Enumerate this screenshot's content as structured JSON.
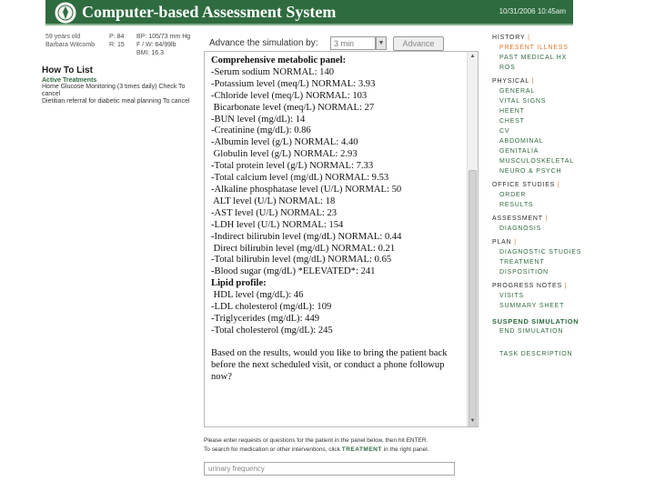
{
  "header": {
    "title": "Computer-based Assessment System",
    "date": "10/31/2006 10:45am"
  },
  "patient": {
    "age": "59 years old",
    "name": "Barbara Witcomb",
    "p_label": "P:",
    "p_value": "84",
    "r_label": "R:",
    "r_value": "15",
    "bp_label": "BP:",
    "bp_value": "105/73 mm Hg",
    "fw_label": "F / W:",
    "fw_value": "64/99lb",
    "bmi_label": "BMI:",
    "bmi_value": "16.3"
  },
  "howto": {
    "title": "How To List",
    "subtitle": "Active Treatments",
    "items": [
      "Home Glucose Monitoring (3 times daily) Check  To cancel",
      "Dietitian referral for diabetic meal planning  To cancel"
    ]
  },
  "advance": {
    "label": "Advance the simulation by:",
    "select_value": "3 min",
    "button": "Advance"
  },
  "results": {
    "heading": "Comprehensive metabolic panel:",
    "lines": [
      "-Serum sodium NORMAL: 140",
      "-Potassium level (meq/L) NORMAL: 3.93",
      "-Chloride level (meq/L) NORMAL: 103",
      " Bicarbonate level (meq/L) NORMAL: 27",
      "-BUN level (mg/dL): 14",
      "-Creatinine (mg/dL): 0.86",
      "-Albumin level (g/L) NORMAL: 4.40",
      " Globulin level (g/L) NORMAL: 2.93",
      "-Total protein level (g/L) NORMAL: 7.33",
      "-Total calcium level (mg/dL) NORMAL: 9.53",
      "-Alkaline phosphatase level (U/L) NORMAL: 50",
      " ALT level (U/L) NORMAL: 18",
      "-AST level (U/L) NORMAL: 23",
      "-LDH level (U/L) NORMAL: 154",
      "-Indirect bilirubin level (mg/dL) NORMAL: 0.44",
      " Direct bilirubin level (mg/dL) NORMAL: 0.21",
      "-Total bilirubin level (mg/dL) NORMAL: 0.65",
      "-Blood sugar (mg/dL) *ELEVATED*: 241"
    ],
    "lipid_heading": "Lipid profile:",
    "lipid_lines": [
      " HDL level (mg/dL): 46",
      "-LDL cholesterol (mg/dL): 109",
      "-Triglycerides (mg/dL): 449",
      "-Total cholesterol (mg/dL): 245"
    ],
    "question": "Based on the results, would you like to bring the patient back before the next scheduled visit, or conduct a phone followup now?"
  },
  "instructions": {
    "line1": "Please enter requests or questions for the patient in the panel below, then hit ENTER.",
    "line2_prefix": "To search for medication or other interventions, click",
    "line2_keyword": "TREATMENT",
    "line2_suffix": "in the right panel."
  },
  "entry": {
    "value": "urinary frequency"
  },
  "menu": {
    "history": "HISTORY",
    "present_illness": "PRESENT ILLNESS",
    "past_medical_hx": "PAST MEDICAL HX",
    "ros": "ROS",
    "physical": "PHYSICAL",
    "general": "GENERAL",
    "vital_signs": "VITAL SIGNS",
    "heent": "HEENT",
    "chest": "CHEST",
    "cv": "CV",
    "abdominal": "ABDOMINAL",
    "genitalia": "GENITALIA",
    "musculoskeletal": "MUSCULOSKELETAL",
    "neuro_psych": "NEURO & PSYCH",
    "office_studies": "OFFICE STUDIES",
    "order": "ORDER",
    "results": "RESULTS",
    "assessment": "ASSESSMENT",
    "diagnosis": "DIAGNOSIS",
    "plan": "PLAN",
    "diagnostic_studies": "DIAGNOSTIC STUDIES",
    "treatment": "TREATMENT",
    "disposition": "DISPOSITION",
    "progress_notes": "PROGRESS NOTES",
    "visits": "VISITS",
    "summary_sheet": "SUMMARY SHEET",
    "suspend_simulation": "SUSPEND SIMULATION",
    "end_simulation": "END SIMULATION",
    "task_description": "TASK DESCRIPTION",
    "separator": "|"
  },
  "colors": {
    "header_green": "#2e6b3f",
    "accent_orange": "#d8742a"
  }
}
